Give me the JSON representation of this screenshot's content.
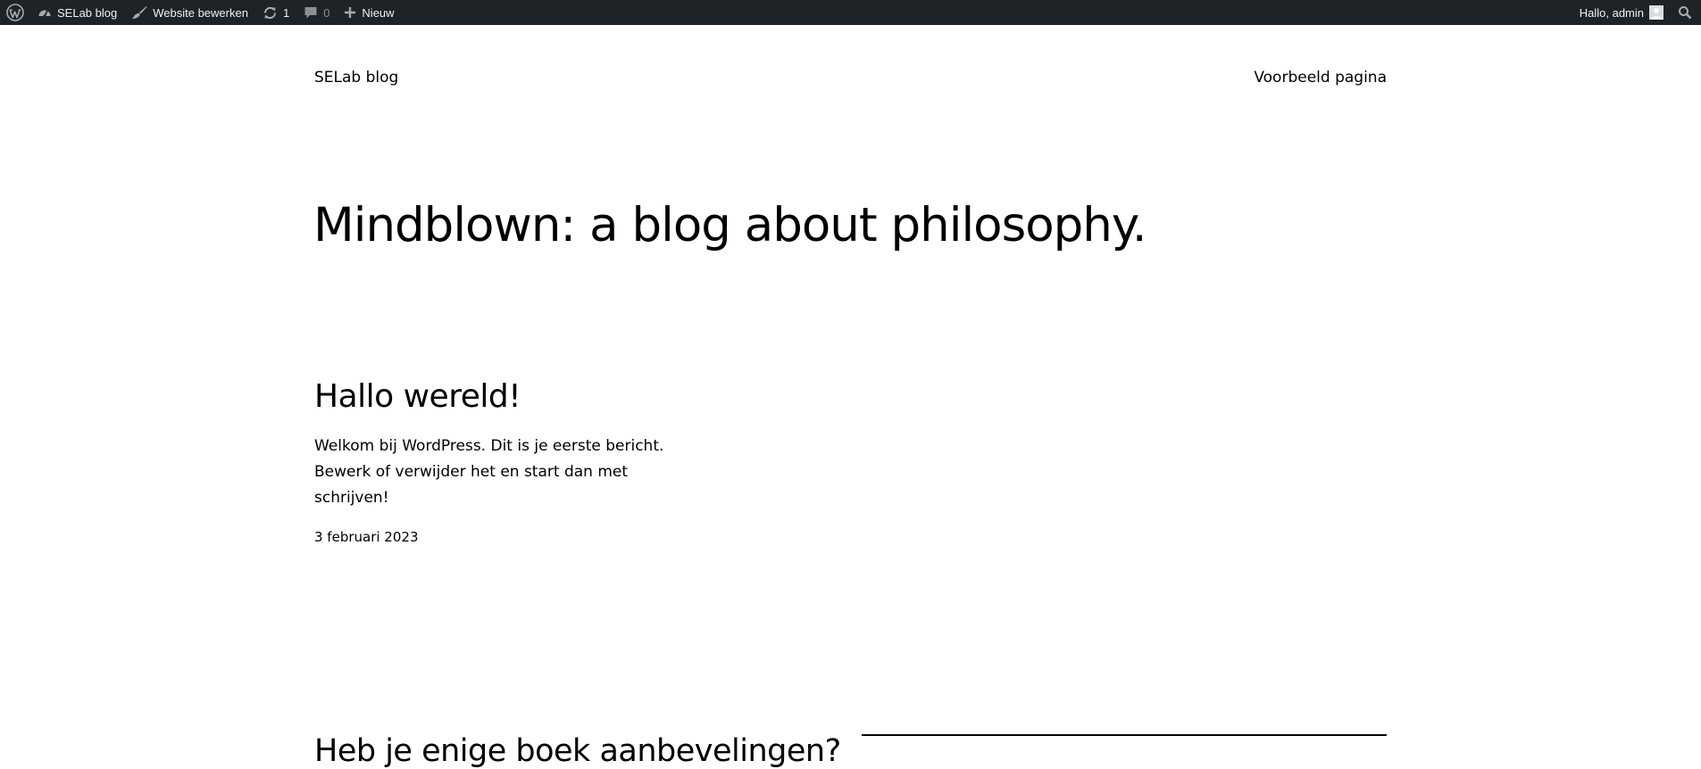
{
  "admin_bar": {
    "wp_logo_icon": "wordpress-icon",
    "site_name": "SELab blog",
    "edit_site_label": "Website bewerken",
    "updates_count": "1",
    "comments_count": "0",
    "new_label": "Nieuw",
    "greeting": "Hallo, admin"
  },
  "site": {
    "title": "SELab blog",
    "nav_item": "Voorbeeld pagina"
  },
  "hero": {
    "heading": "Mindblown: a blog about philosophy."
  },
  "posts": [
    {
      "title": "Hallo wereld!",
      "excerpt": "Welkom bij WordPress. Dit is je eerste bericht. Bewerk of verwijder het en start dan met schrijven!",
      "date": "3 februari 2023"
    },
    {
      "title": "Heb je enige boek aanbevelingen?"
    }
  ],
  "colors": {
    "admin_bar_bg": "#1d2327",
    "admin_bar_text": "#f0f0f1",
    "page_bg": "#ffffff",
    "text": "#000000"
  }
}
